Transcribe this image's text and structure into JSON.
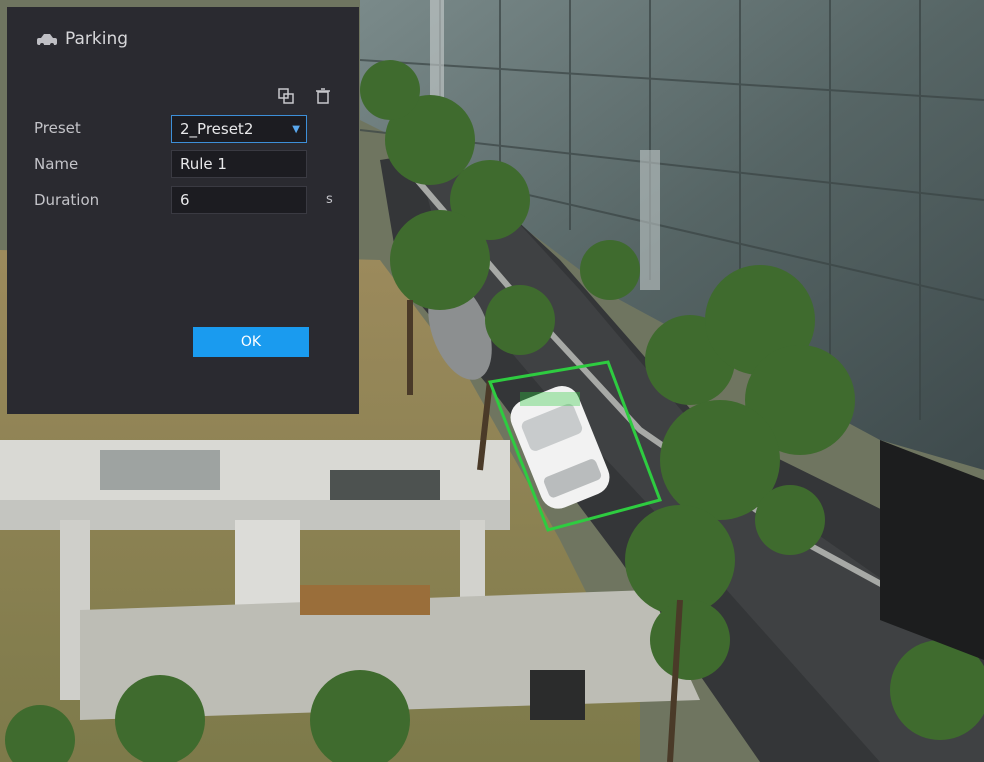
{
  "panel": {
    "title": "Parking",
    "icon": "car-icon",
    "tools": {
      "copy_icon": "copy-icon",
      "delete_icon": "trash-icon"
    },
    "fields": {
      "preset": {
        "label": "Preset",
        "value": "2_Preset2"
      },
      "name": {
        "label": "Name",
        "value": "Rule 1"
      },
      "duration": {
        "label": "Duration",
        "value": "6",
        "unit": "s"
      }
    },
    "ok_label": "OK"
  },
  "colors": {
    "panel_bg": "#2a2a30",
    "accent": "#1a9bef",
    "rule_outline": "#2ecc40"
  }
}
